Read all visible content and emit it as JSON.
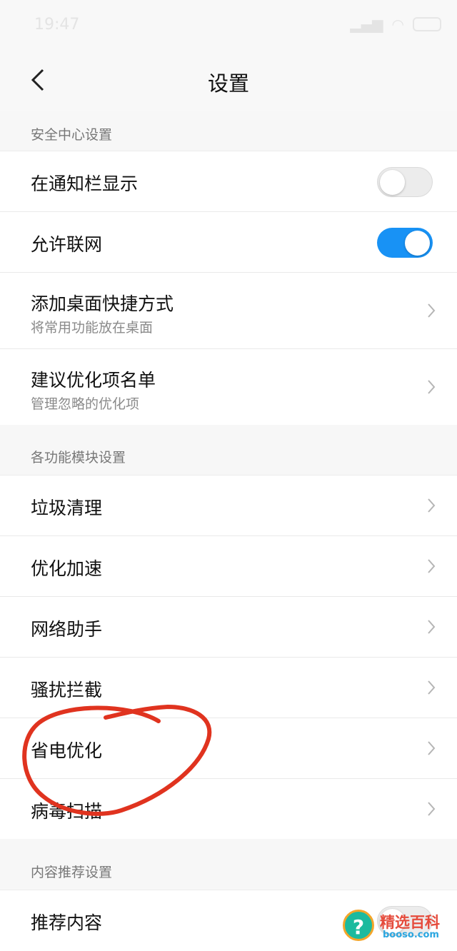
{
  "status_bar": {
    "time": "19:47"
  },
  "header": {
    "title": "设置",
    "back_icon": "back-chevron-icon"
  },
  "sections": [
    {
      "title": "安全中心设置",
      "rows": [
        {
          "label": "在通知栏显示",
          "control": "toggle",
          "checked": false
        },
        {
          "label": "允许联网",
          "control": "toggle",
          "checked": true
        },
        {
          "label": "添加桌面快捷方式",
          "sub": "将常用功能放在桌面",
          "control": "chevron"
        },
        {
          "label": "建议优化项名单",
          "sub": "管理忽略的优化项",
          "control": "chevron"
        }
      ]
    },
    {
      "title": "各功能模块设置",
      "rows": [
        {
          "label": "垃圾清理",
          "control": "chevron"
        },
        {
          "label": "优化加速",
          "control": "chevron"
        },
        {
          "label": "网络助手",
          "control": "chevron"
        },
        {
          "label": "骚扰拦截",
          "control": "chevron"
        },
        {
          "label": "省电优化",
          "control": "chevron"
        },
        {
          "label": "病毒扫描",
          "control": "chevron"
        }
      ]
    },
    {
      "title": "内容推荐设置",
      "rows": [
        {
          "label": "推荐内容",
          "control": "toggle",
          "checked": false
        }
      ]
    }
  ],
  "colors": {
    "accent": "#1892f5",
    "annotation": "#e0331f"
  },
  "watermark": {
    "name": "精选百科",
    "domain": "booso.com"
  }
}
